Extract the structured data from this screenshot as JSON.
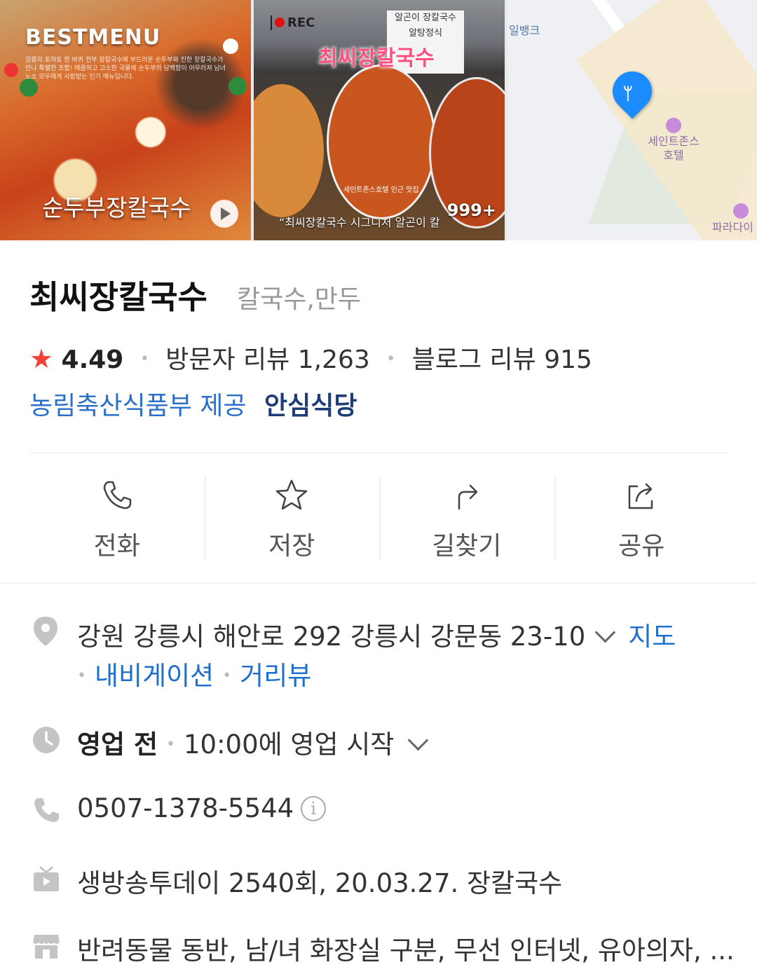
{
  "gallery": {
    "photo1": {
      "heading": "BESTMENU",
      "desc": "강릉의 토마토 한 바퀴 전부 장칼국수에 부드러운 순두부와 진한 장칼국수가 만나 특별한 조합! 매콤하고 고소한 국물에 순두부의 담백함이 어우러져 남녀노소 모두에게 사랑받는 인기 메뉴입니다.",
      "caption": "순두부장칼국수"
    },
    "photo2": {
      "rec": "REC",
      "sign": [
        "알곤이 장칼국수",
        "알탕정식"
      ],
      "title": "최씨장칼국수",
      "near": "세인트존스호텔 인근 맛집",
      "quote": "“최씨장칼국수 시그니처 알곤이 칼",
      "count": "999+"
    },
    "map": {
      "label_bank": "일뱅크",
      "label_hotel": "세인트존스\n호텔",
      "label_paradise": "파라다이"
    }
  },
  "place": {
    "name": "최씨장칼국수",
    "category": "칼국수,만두",
    "rating": "4.49",
    "visitor_reviews": "방문자 리뷰 1,263",
    "blog_reviews": "블로그 리뷰 915",
    "cert_source": "농림축산식품부 제공",
    "cert_badge": "안심식당"
  },
  "actions": [
    {
      "label": "전화",
      "icon": "phone-icon"
    },
    {
      "label": "저장",
      "icon": "star-icon"
    },
    {
      "label": "길찾기",
      "icon": "directions-icon"
    },
    {
      "label": "공유",
      "icon": "share-icon"
    }
  ],
  "info": {
    "address": "강원 강릉시 해안로 292 강릉시 강문동 23-10",
    "map_link": "지도",
    "nav_link": "내비게이션",
    "street_link": "거리뷰",
    "status": "영업 전",
    "hours": "10:00에 영업 시작",
    "phone": "0507-1378-5544",
    "tv": "생방송투데이 2540회, 20.03.27. 장칼국수",
    "amenities": "반려동물 동반, 남/녀 화장실 구분, 무선 인터넷, 유아의자, ..."
  },
  "colors": {
    "accent_blue": "#1f6fcf",
    "star_red": "#f44336",
    "pin_blue": "#1a8cff"
  }
}
